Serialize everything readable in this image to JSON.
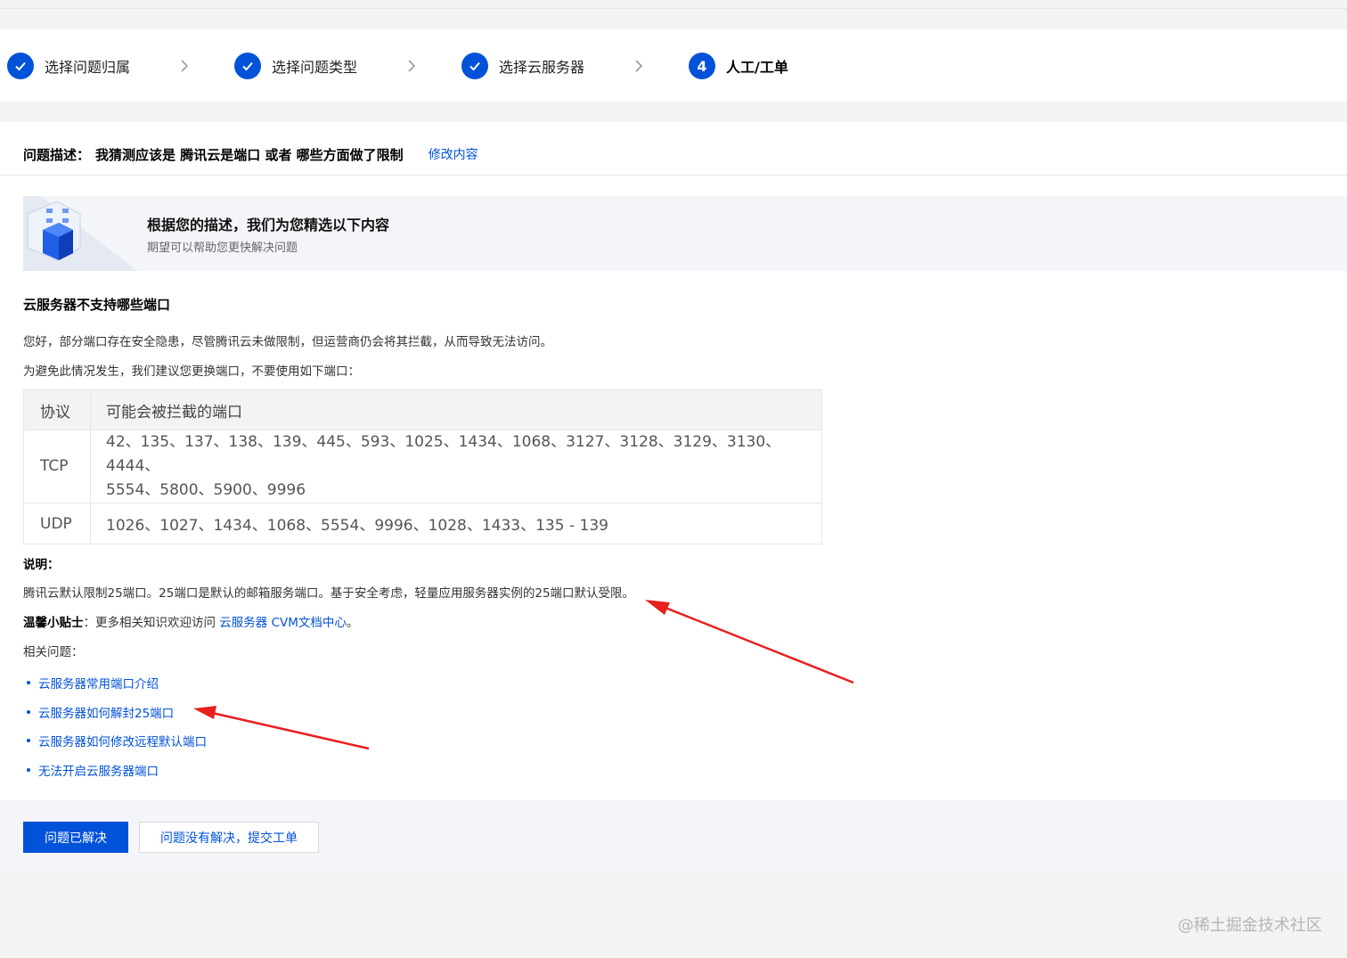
{
  "steps": [
    {
      "label": "选择问题归属",
      "status": "done"
    },
    {
      "label": "选择问题类型",
      "status": "done"
    },
    {
      "label": "选择云服务器",
      "status": "done"
    },
    {
      "label": "人工/工单",
      "number": "4",
      "status": "active"
    }
  ],
  "description": {
    "label": "问题描述：",
    "text": "我猜测应该是 腾讯云是端口 或者 哪些方面做了限制",
    "edit_link": "修改内容"
  },
  "banner": {
    "title": "根据您的描述，我们为您精选以下内容",
    "subtitle": "期望可以帮助您更快解决问题"
  },
  "article": {
    "title": "云服务器不支持哪些端口",
    "intro1": "您好，部分端口存在安全隐患，尽管腾讯云未做限制，但运营商仍会将其拦截，从而导致无法访问。",
    "intro2": "为避免此情况发生，我们建议您更换端口，不要使用如下端口：",
    "table": {
      "headers": [
        "协议",
        "可能会被拦截的端口"
      ],
      "rows": [
        {
          "protocol": "TCP",
          "ports_line1": "42、135、137、138、139、445、593、1025、1434、1068、3127、3128、3129、3130、4444、",
          "ports_line2": "5554、5800、5900、9996"
        },
        {
          "protocol": "UDP",
          "ports_line1": "1026、1027、1434、1068、5554、9996、1028、1433、135 - 139"
        }
      ]
    },
    "note_label": "说明：",
    "note_text": "腾讯云默认限制25端口。25端口是默认的邮箱服务端口。基于安全考虑，轻量应用服务器实例的25端口默认受限。",
    "tip_label": "温馨小贴士",
    "tip_text": "：更多相关知识欢迎访问",
    "tip_link": "云服务器 CVM文档中心",
    "tip_end": "。",
    "related_label": "相关问题：",
    "related": [
      "云服务器常用端口介绍",
      "云服务器如何解封25端口",
      "云服务器如何修改远程默认端口",
      "无法开启云服务器端口"
    ]
  },
  "buttons": {
    "resolved": "问题已解决",
    "not_resolved": "问题没有解决，提交工单"
  },
  "watermark": "@稀土掘金技术社区",
  "colors": {
    "accent": "#0052d9",
    "annotation_arrow": "#e8201e"
  }
}
